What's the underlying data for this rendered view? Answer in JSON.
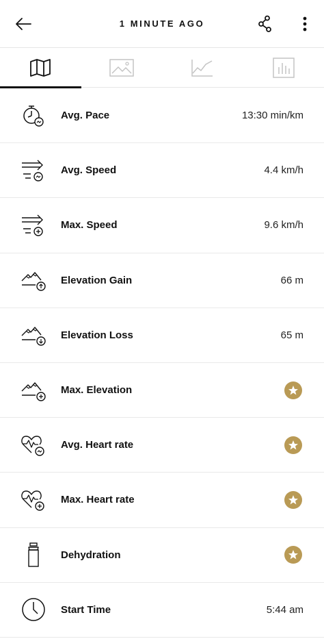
{
  "header": {
    "title": "1 MINUTE AGO",
    "back_icon": "arrow-left-icon",
    "share_icon": "share-icon",
    "more_icon": "more-vertical-icon"
  },
  "tabs": [
    {
      "name": "map",
      "icon": "map-icon",
      "active": true
    },
    {
      "name": "photos",
      "icon": "image-icon",
      "active": false
    },
    {
      "name": "graph",
      "icon": "line-chart-icon",
      "active": false
    },
    {
      "name": "stats",
      "icon": "bar-chart-icon",
      "active": false
    }
  ],
  "stats": [
    {
      "label": "Avg. Pace",
      "value": "13:30 min/km",
      "icon": "stopwatch-icon"
    },
    {
      "label": "Avg. Speed",
      "value": "4.4 km/h",
      "icon": "speed-avg-icon"
    },
    {
      "label": "Max. Speed",
      "value": "9.6 km/h",
      "icon": "speed-max-icon"
    },
    {
      "label": "Elevation Gain",
      "value": "66 m",
      "icon": "elevation-gain-icon"
    },
    {
      "label": "Elevation Loss",
      "value": "65 m",
      "icon": "elevation-loss-icon"
    },
    {
      "label": "Max. Elevation",
      "value": null,
      "premium": true,
      "icon": "elevation-max-icon"
    },
    {
      "label": "Avg. Heart rate",
      "value": null,
      "premium": true,
      "icon": "heart-rate-avg-icon"
    },
    {
      "label": "Max. Heart rate",
      "value": null,
      "premium": true,
      "icon": "heart-rate-max-icon"
    },
    {
      "label": "Dehydration",
      "value": null,
      "premium": true,
      "icon": "bottle-icon"
    },
    {
      "label": "Start Time",
      "value": "5:44 am",
      "icon": "clock-icon"
    }
  ],
  "colors": {
    "premium_badge": "#b99a55",
    "divider": "#e9e9e9",
    "text": "#111111"
  }
}
